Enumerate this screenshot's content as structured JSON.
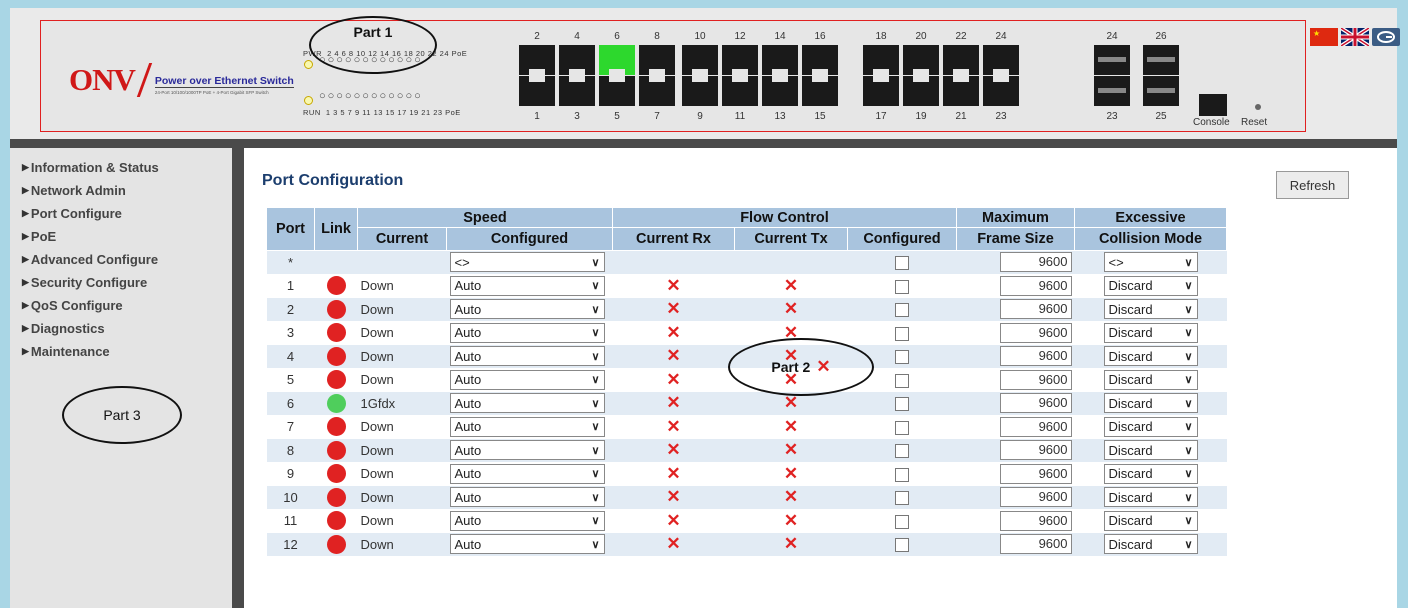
{
  "header": {
    "logo_brand": "ONV",
    "logo_title": "Power over Ethernet Switch",
    "logo_subtitle": "24-Port 10/100/1000TP PoE + 4-Port Gigabit SFP Switch",
    "pwr_label": "PWR",
    "run_label": "RUN",
    "pwr_ports": "2 4 6 8 10 12 14 16 18 20 22 24 PoE",
    "run_ports": "1 3 5 7 9 11 13 15 17 19 21 23 PoE",
    "led_row": "○○○○○○○○○○○○",
    "console_label": "Console",
    "reset_label": "Reset",
    "top_port_numbers": [
      "2",
      "4",
      "6",
      "8",
      "10",
      "12",
      "14",
      "16",
      "18",
      "20",
      "22",
      "24",
      "24",
      "26"
    ],
    "bottom_port_numbers": [
      "1",
      "3",
      "5",
      "7",
      "9",
      "11",
      "13",
      "15",
      "17",
      "19",
      "21",
      "23",
      "23",
      "25"
    ],
    "active_port": "6",
    "annotations": {
      "part1": "Part 1",
      "part2": "Part 2",
      "part3": "Part 3"
    }
  },
  "sidebar": {
    "items": [
      {
        "label": "Information & Status"
      },
      {
        "label": "Network Admin"
      },
      {
        "label": "Port Configure"
      },
      {
        "label": "PoE"
      },
      {
        "label": "Advanced Configure"
      },
      {
        "label": "Security Configure"
      },
      {
        "label": "QoS Configure"
      },
      {
        "label": "Diagnostics"
      },
      {
        "label": "Maintenance"
      }
    ]
  },
  "main": {
    "title": "Port Configuration",
    "refresh_label": "Refresh",
    "headers": {
      "port": "Port",
      "link": "Link",
      "speed": "Speed",
      "current": "Current",
      "configured": "Configured",
      "flow_control": "Flow Control",
      "current_rx": "Current Rx",
      "current_tx": "Current Tx",
      "fc_configured": "Configured",
      "max_frame_1": "Maximum",
      "max_frame_2": "Frame Size",
      "excessive_1": "Excessive",
      "excessive_2": "Collision Mode"
    },
    "wildcard_row": {
      "port": "*",
      "speed": "<>",
      "frame": "9600",
      "collision": "<>"
    },
    "rows": [
      {
        "port": "1",
        "link": "down",
        "current": "Down",
        "speed": "Auto",
        "frame": "9600",
        "collision": "Discard"
      },
      {
        "port": "2",
        "link": "down",
        "current": "Down",
        "speed": "Auto",
        "frame": "9600",
        "collision": "Discard"
      },
      {
        "port": "3",
        "link": "down",
        "current": "Down",
        "speed": "Auto",
        "frame": "9600",
        "collision": "Discard"
      },
      {
        "port": "4",
        "link": "down",
        "current": "Down",
        "speed": "Auto",
        "frame": "9600",
        "collision": "Discard"
      },
      {
        "port": "5",
        "link": "down",
        "current": "Down",
        "speed": "Auto",
        "frame": "9600",
        "collision": "Discard"
      },
      {
        "port": "6",
        "link": "up",
        "current": "1Gfdx",
        "speed": "Auto",
        "frame": "9600",
        "collision": "Discard"
      },
      {
        "port": "7",
        "link": "down",
        "current": "Down",
        "speed": "Auto",
        "frame": "9600",
        "collision": "Discard"
      },
      {
        "port": "8",
        "link": "down",
        "current": "Down",
        "speed": "Auto",
        "frame": "9600",
        "collision": "Discard"
      },
      {
        "port": "9",
        "link": "down",
        "current": "Down",
        "speed": "Auto",
        "frame": "9600",
        "collision": "Discard"
      },
      {
        "port": "10",
        "link": "down",
        "current": "Down",
        "speed": "Auto",
        "frame": "9600",
        "collision": "Discard"
      },
      {
        "port": "11",
        "link": "down",
        "current": "Down",
        "speed": "Auto",
        "frame": "9600",
        "collision": "Discard"
      },
      {
        "port": "12",
        "link": "down",
        "current": "Down",
        "speed": "Auto",
        "frame": "9600",
        "collision": "Discard"
      }
    ]
  },
  "colors": {
    "link_down": "#e02222",
    "link_up": "#4fce5c",
    "header_bg": "#a9c4de",
    "title": "#1c3e6e"
  }
}
